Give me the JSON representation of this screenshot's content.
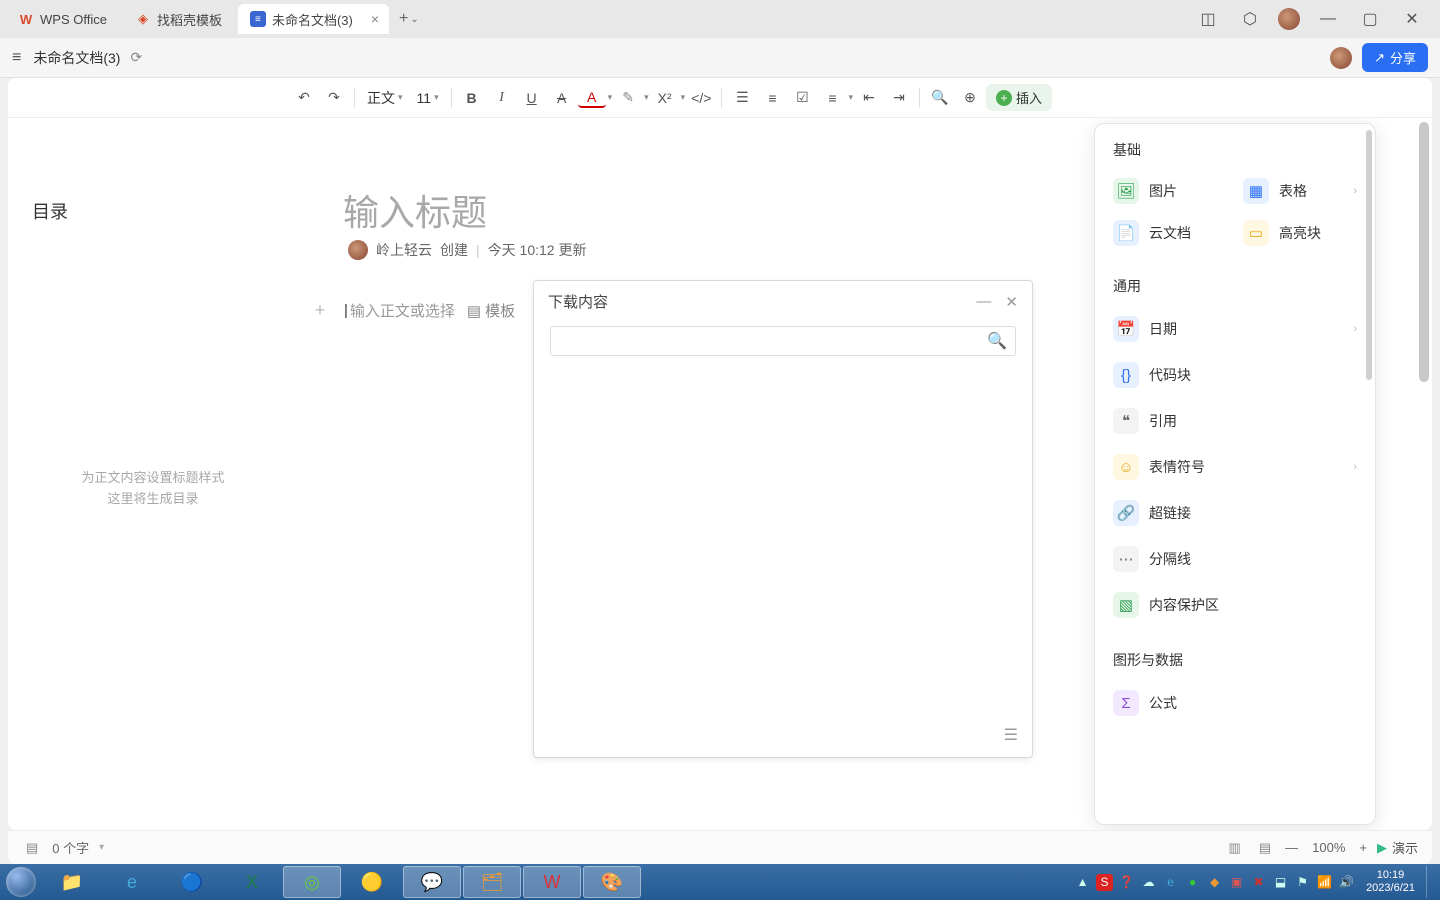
{
  "titlebar": {
    "tabs": [
      {
        "icon": "W",
        "icon_color": "#d84a2b",
        "label": "WPS Office"
      },
      {
        "icon": "◈",
        "icon_color": "#d84a2b",
        "label": "找稻壳模板"
      },
      {
        "icon": "≡",
        "icon_color": "#3a66d1",
        "label": "未命名文档(3)"
      }
    ],
    "close_glyph": "×",
    "newtab_glyph": "+"
  },
  "docrow": {
    "title": "未命名文档(3)",
    "share_label": "分享"
  },
  "toolbar": {
    "style_label": "正文",
    "font_size": "11",
    "insert_label": "插入"
  },
  "outline": {
    "heading": "目录",
    "hint_line1": "为正文内容设置标题样式",
    "hint_line2": "这里将生成目录"
  },
  "page": {
    "title_placeholder": "输入标题",
    "author": "岭上轻云",
    "created_label": "创建",
    "updated_text": "今天 10:12 更新",
    "body_placeholder": "输入正文或选择",
    "template_label": "模板"
  },
  "download_popup": {
    "title": "下载内容"
  },
  "insert_panel": {
    "sections": {
      "basic": {
        "title": "基础",
        "items": [
          {
            "icon": "🖼",
            "label": "图片",
            "cls": "c-green"
          },
          {
            "icon": "▦",
            "label": "表格",
            "cls": "c-blue",
            "chevron": true
          },
          {
            "icon": "📄",
            "label": "云文档",
            "cls": "c-blue"
          },
          {
            "icon": "▭",
            "label": "高亮块",
            "cls": "c-yellow"
          }
        ]
      },
      "general": {
        "title": "通用",
        "items": [
          {
            "icon": "📅",
            "label": "日期",
            "cls": "c-blue",
            "chevron": true
          },
          {
            "icon": "{}",
            "label": "代码块",
            "cls": "c-blue"
          },
          {
            "icon": "❝",
            "label": "引用",
            "cls": "c-gray"
          },
          {
            "icon": "☺",
            "label": "表情符号",
            "cls": "c-yellow",
            "chevron": true
          },
          {
            "icon": "🔗",
            "label": "超链接",
            "cls": "c-blue"
          },
          {
            "icon": "⋯",
            "label": "分隔线",
            "cls": "c-gray"
          },
          {
            "icon": "▧",
            "label": "内容保护区",
            "cls": "c-green"
          }
        ]
      },
      "shapes": {
        "title": "图形与数据",
        "items": [
          {
            "icon": "Σx",
            "label": "公式",
            "cls": "c-purple"
          }
        ]
      }
    }
  },
  "statusbar": {
    "word_count": "0 个字",
    "zoom": "100%",
    "present_label": "演示"
  },
  "taskbar": {
    "clock_time": "10:19",
    "clock_date": "2023/6/21"
  }
}
